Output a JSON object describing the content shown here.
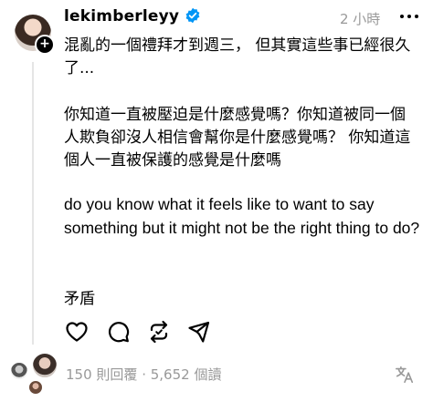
{
  "post": {
    "username": "lekimberleyy",
    "timestamp": "2 小時",
    "paragraphs": [
      "混亂的一個禮拜才到週三，  但其實這些事已經很久了...",
      "你知道一直被壓迫是什麼感覺嗎？你知道被同一個人欺負卻沒人相信會幫你是什麼感覺嗎？  你知道這個人一直被保護的感覺是什麼嗎",
      "do you know what it feels like to want to say something but it might not be the right thing to do?",
      "矛盾"
    ]
  },
  "footer": {
    "replies": "150 則回覆",
    "separator": "·",
    "views": "5,652 個讀"
  },
  "colors": {
    "verified": "#0095f6",
    "muted": "#999999",
    "thread_line": "#e5e5e5"
  },
  "icons": [
    "more-icon",
    "heart-icon",
    "comment-icon",
    "repost-icon",
    "share-icon",
    "translate-icon",
    "verified-badge-icon",
    "add-icon"
  ]
}
